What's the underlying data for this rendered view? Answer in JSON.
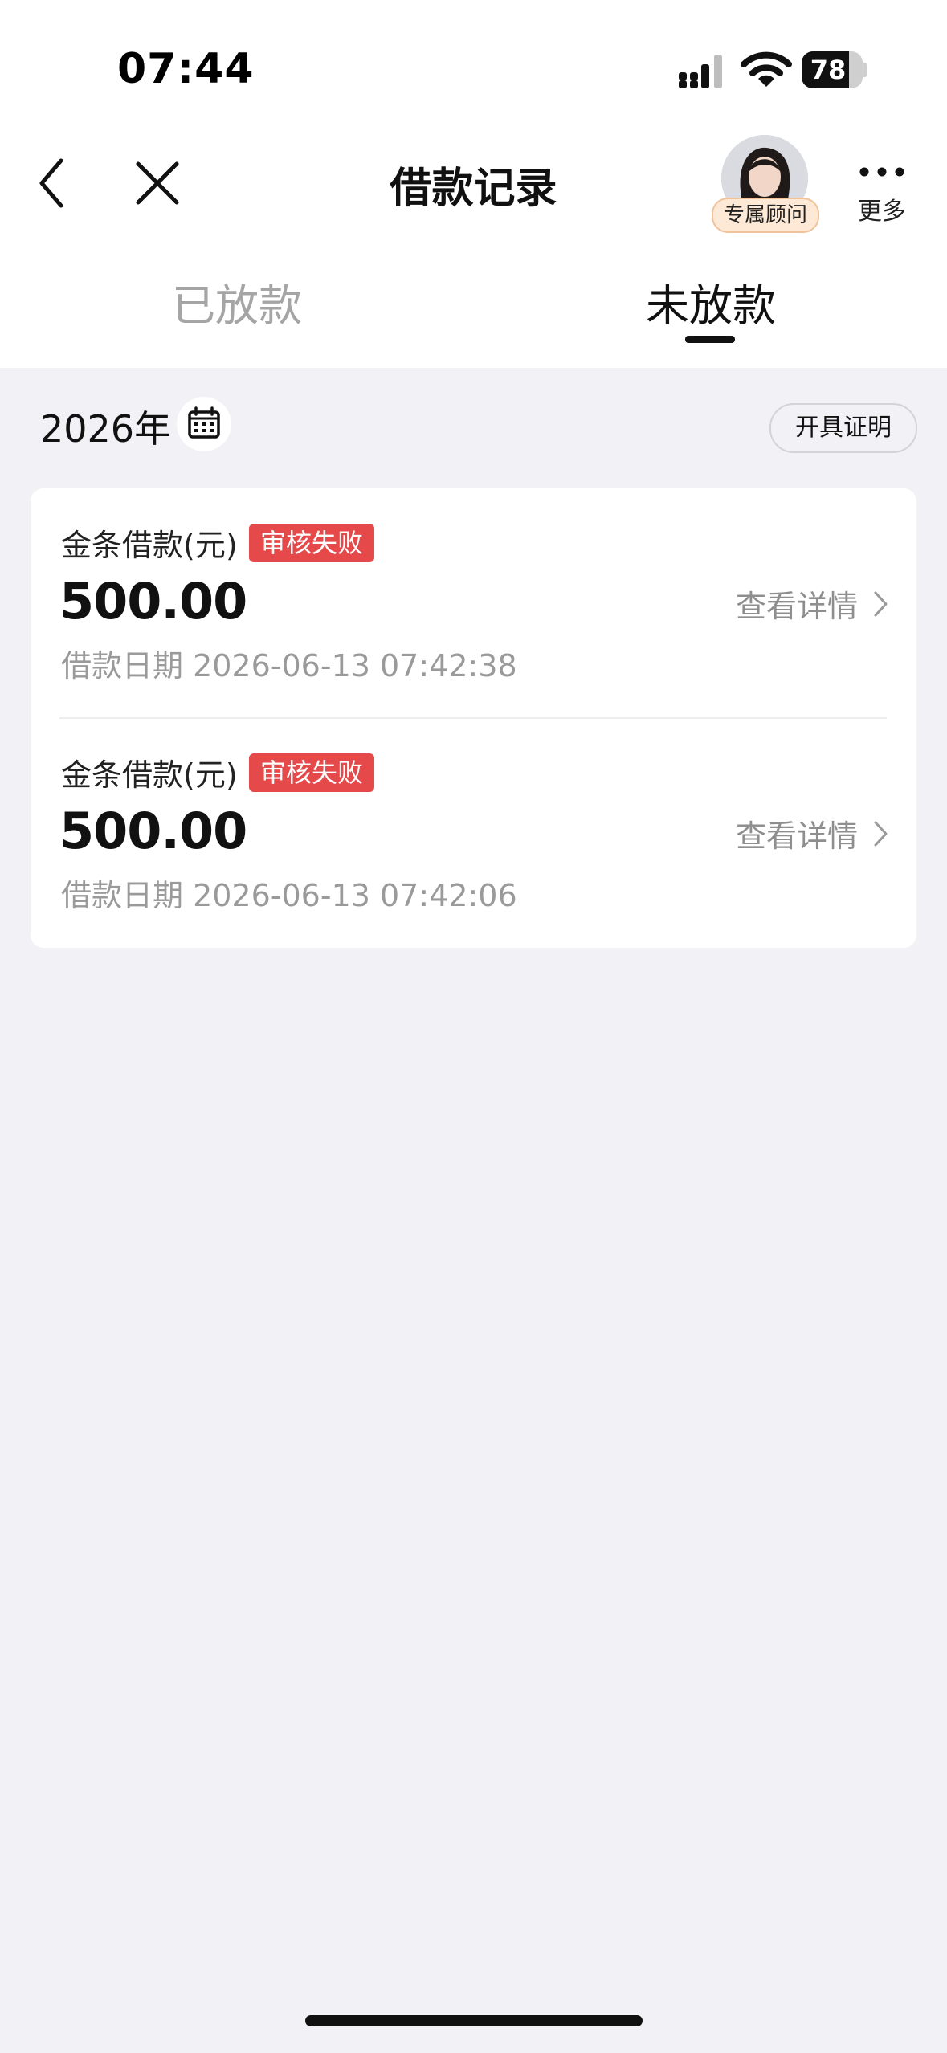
{
  "status_bar": {
    "time": "07:44",
    "battery": "78",
    "battery_level": 0.78
  },
  "nav": {
    "title": "借款记录",
    "advisor_badge": "专属顾问",
    "more_label": "更多"
  },
  "tabs": [
    {
      "label": "已放款",
      "selected": false
    },
    {
      "label": "未放款",
      "selected": true
    }
  ],
  "filter": {
    "year": "2026年",
    "certificate_button": "开具证明"
  },
  "records": [
    {
      "label": "金条借款(元)",
      "status": "审核失败",
      "amount": "500.00",
      "date": "借款日期 2026-06-13 07:42:38",
      "detail_link": "查看详情"
    },
    {
      "label": "金条借款(元)",
      "status": "审核失败",
      "amount": "500.00",
      "date": "借款日期 2026-06-13 07:42:06",
      "detail_link": "查看详情"
    }
  ],
  "colors": {
    "status_failed": "#e5494a",
    "page_background": "#f1f1f6",
    "accent_text": "#111111"
  }
}
